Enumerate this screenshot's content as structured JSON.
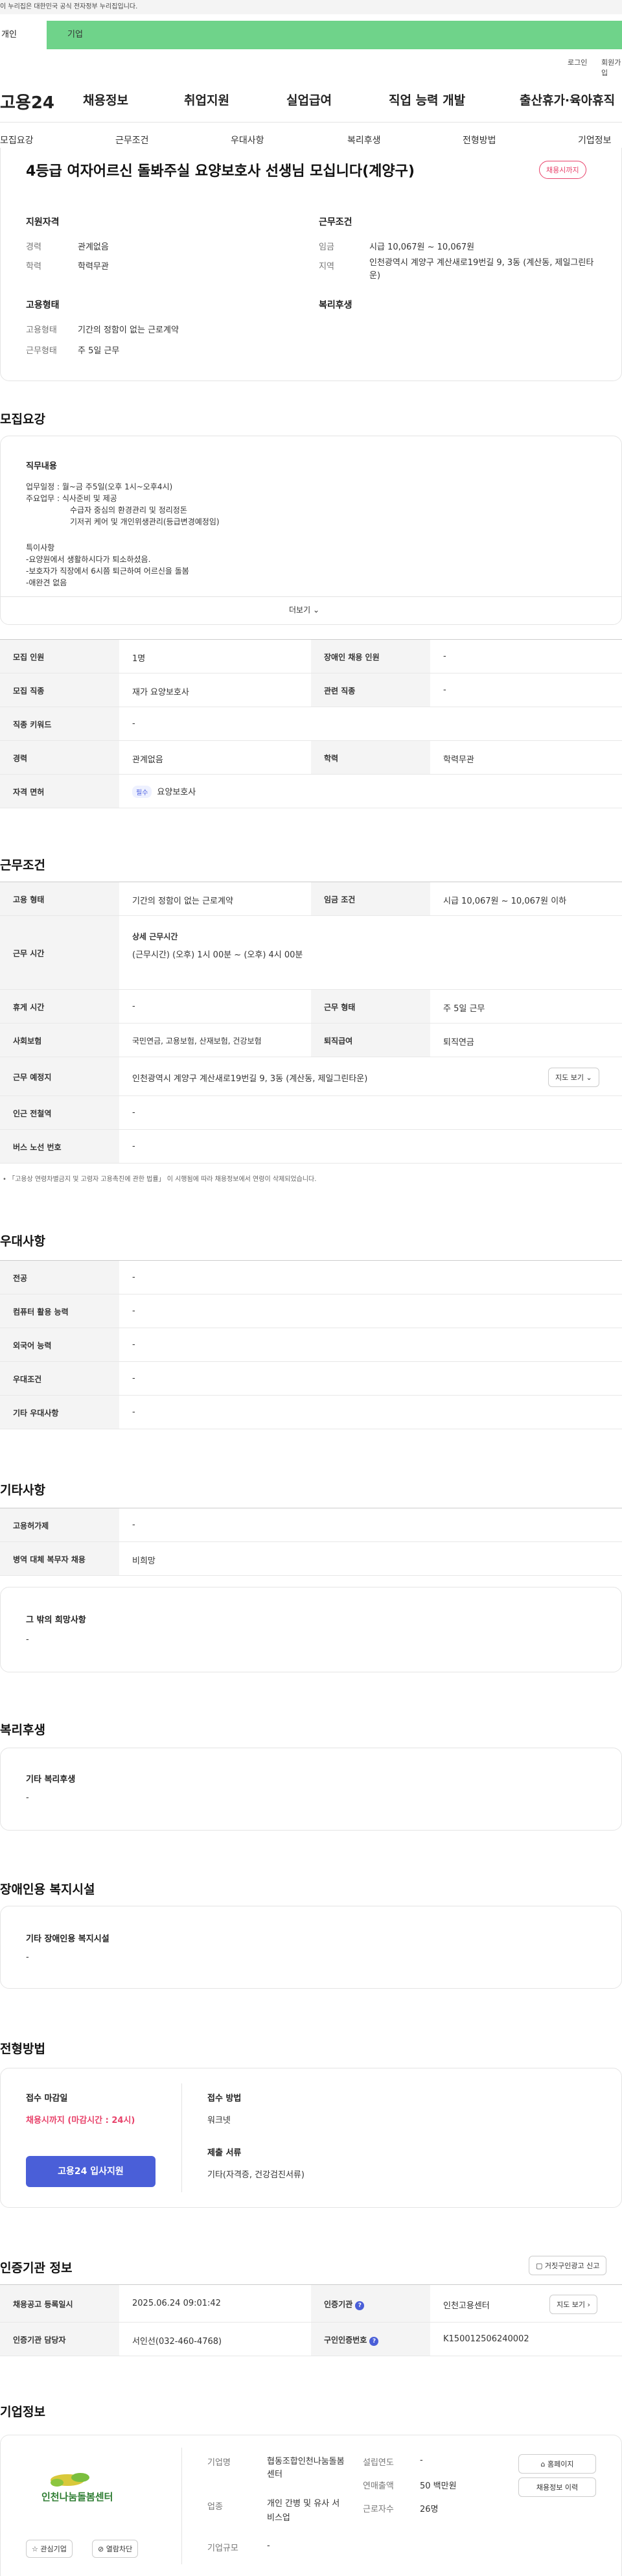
{
  "gov_banner": "이 누리집은 대한민국 공식 전자정부 누리집입니다.",
  "user_tabs": {
    "individual": "개인",
    "business": "기업"
  },
  "util_links": [
    "로그인",
    "회원가입"
  ],
  "site_name": "고용24",
  "gnb": [
    "채용정보",
    "취업지원",
    "실업급여",
    "직업 능력 개발",
    "출산휴가·육아휴직"
  ],
  "anchors": [
    "모집요강",
    "근무조건",
    "우대사항",
    "복리후생",
    "전형방법",
    "기업정보"
  ],
  "header_card": {
    "title": "4등급 여자어르신 돌봐주실 요양보호사 선생님 모십니다(계양구)",
    "status_badge": "채용시까지",
    "qual_title": "지원자격",
    "career_label": "경력",
    "career_value": "관계없음",
    "edu_label": "학력",
    "edu_value": "학력무관",
    "cond_title": "근무조건",
    "wage_label": "임금",
    "wage_value": "시급 10,067원 ~ 10,067원",
    "area_label": "지역",
    "area_value": "인천광역시 계양구 계산새로19번길 9, 3동 (계산동, 제일그린타운)",
    "emp_title": "고용형태",
    "emp_label": "고용형태",
    "emp_value": "기간의 정함이 없는 근로계약",
    "worktype_label": "근무형태",
    "worktype_value": "주 5일 근무",
    "welfare_title": "복리후생"
  },
  "recruit": {
    "section_title": "모집요강",
    "duty_title": "직무내용",
    "duty_lines": [
      "업무일정 : 월~금 주5일(오후 1시~오후4시)",
      "주요업무 : 식사준비 및 제공",
      "수급자 중심의 환경관리 및 정리정돈",
      "기저귀 케어 및 개인위생관리(등급변경예정임)",
      "",
      "특이사항",
      "-요양원에서 생활하시다가 퇴소하셨음.",
      "-보호자가 직장에서 6시쯤 퇴근하여 어르신을 돌봄",
      "-애완견 없음"
    ],
    "more_label": "더보기",
    "rows": [
      {
        "k1": "모집 인원",
        "v1": "1명",
        "k2": "장애인 채용 인원",
        "v2": "-"
      },
      {
        "k1": "모집 직종",
        "v1": "재가 요양보호사",
        "k2": "관련 직종",
        "v2": "-"
      },
      {
        "k1": "직종 키워드",
        "v1": "-"
      },
      {
        "k1": "경력",
        "v1": "관계없음",
        "k2": "학력",
        "v2": "학력무관"
      },
      {
        "k1": "자격 면허",
        "v1": "요양보호사",
        "tag": "필수"
      }
    ]
  },
  "work": {
    "section_title": "근무조건",
    "emp_type_k": "고용 형태",
    "emp_type_v": "기간의 정함이 없는 근로계약",
    "wage_k": "임금 조건",
    "wage_v": "시급 10,067원 ~ 10,067원 이하",
    "hours_k": "근무 시간",
    "hours_detail_title": "상세 근무시간",
    "hours_detail": "(근무시간) (오후) 1시 00분 ~ (오후) 4시 00분",
    "rest_k": "휴게 시간",
    "rest_v": "-",
    "form_k": "근무 형태",
    "form_v": "주 5일 근무",
    "insurance_k": "사회보험",
    "insurance_v": "국민연금, 고용보험, 산재보험, 건강보험",
    "retire_k": "퇴직급여",
    "retire_v": "퇴직연금",
    "place_k": "근무 예정지",
    "place_v": "인천광역시 계양구 계산새로19번길 9, 3동 (계산동, 제일그린타운)",
    "map_btn": "지도 보기",
    "subway_k": "인근 전철역",
    "subway_v": "-",
    "bus_k": "버스 노선 번호",
    "bus_v": "-",
    "notice": "「고용상 연령차별금지 및 고령자 고용촉진에 관한 법률」 이 시행됨에 따라 채용정보에서 연령이 삭제되었습니다."
  },
  "pref": {
    "section_title": "우대사항",
    "rows": [
      {
        "k": "전공",
        "v": "-"
      },
      {
        "k": "컴퓨터 활용 능력",
        "v": "-"
      },
      {
        "k": "외국어 능력",
        "v": "-"
      },
      {
        "k": "우대조건",
        "v": "-"
      },
      {
        "k": "기타 우대사항",
        "v": "-"
      }
    ]
  },
  "etc": {
    "section_title": "기타사항",
    "rows": [
      {
        "k": "고용허가제",
        "v": "-"
      },
      {
        "k": "병역 대체 복무자 채용",
        "v": "비희망"
      }
    ],
    "hope_title": "그 밖의 희망사항",
    "hope_value": "-"
  },
  "welfare": {
    "section_title": "복리후생",
    "box_title": "기타 복리후생",
    "box_value": "-"
  },
  "disabled": {
    "section_title": "장애인용 복지시설",
    "box_title": "기타 장애인용 복지시설",
    "box_value": "-"
  },
  "selection": {
    "section_title": "전형방법",
    "deadline_title": "접수 마감일",
    "deadline_value": "채용시까지 (마감시간 : 24시)",
    "apply_btn": "고용24 입사지원",
    "method_title": "접수 방법",
    "method_value": "워크넷",
    "docs_title": "제출 서류",
    "docs_value": "기타(자격증, 건강검진서류)"
  },
  "agency": {
    "section_title": "인증기관 정보",
    "report_btn": "거짓구인광고 신고",
    "reg_date_k": "채용공고 등록일시",
    "reg_date_v": "2025.06.24 09:01:42",
    "agency_k": "인증기관",
    "agency_v": "인천고용센터",
    "manager_k": "인증기관 담당자",
    "manager_v": "서인선(032-460-4768)",
    "cert_k": "구인인증번호",
    "cert_v": "K150012506240002",
    "map_btn": "지도 보기"
  },
  "company": {
    "section_title": "기업정보",
    "logo_text": "인천나눔돌봄센터",
    "interest_btn": "관심기업",
    "block_btn": "열람차단",
    "name_k": "기업명",
    "name_v": "협동조합인천나눔돌봄센터",
    "biz_k": "업종",
    "biz_v": "개인 간병 및 유사 서비스업",
    "size_k": "기업규모",
    "size_v": "-",
    "year_k": "설립연도",
    "year_v": "-",
    "sales_k": "연매출액",
    "sales_v": "50 백만원",
    "emp_k": "근로자수",
    "emp_v": "26명",
    "home_btn": "홈페이지",
    "history_btn": "채용정보 이력"
  }
}
